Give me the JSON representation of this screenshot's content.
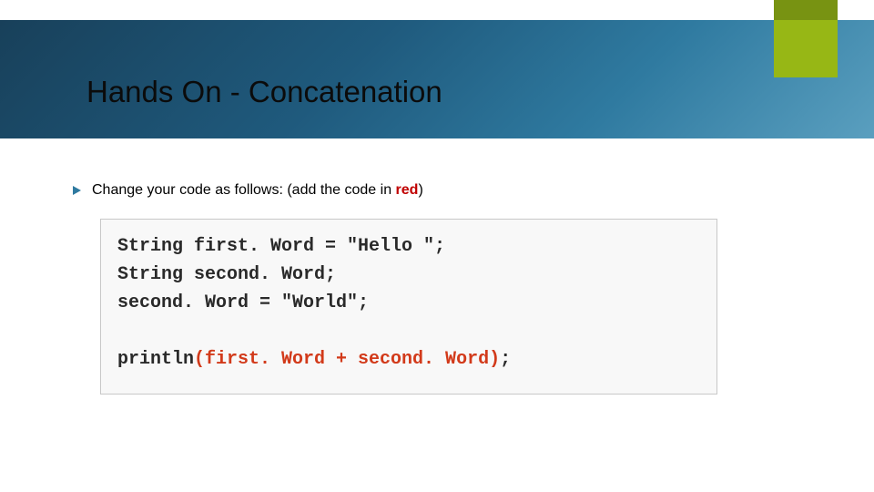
{
  "title": "Hands On - Concatenation",
  "bullet": {
    "text_before": "Change your code as follows: (add the code in ",
    "red_word": "red",
    "text_after": ")"
  },
  "code": {
    "line1": "String first. Word = \"Hello \";",
    "line2": "String second. Word;",
    "line3": "second. Word = \"World\";",
    "blank": "",
    "line5_before": "println",
    "line5_red": "(first. Word + second. Word)",
    "line5_after": ";"
  },
  "colors": {
    "accent_olive": "#97b715",
    "header_gradient_start": "#18405a",
    "header_gradient_end": "#5a9fbf",
    "red": "#c00000",
    "code_red": "#d23a1a"
  }
}
